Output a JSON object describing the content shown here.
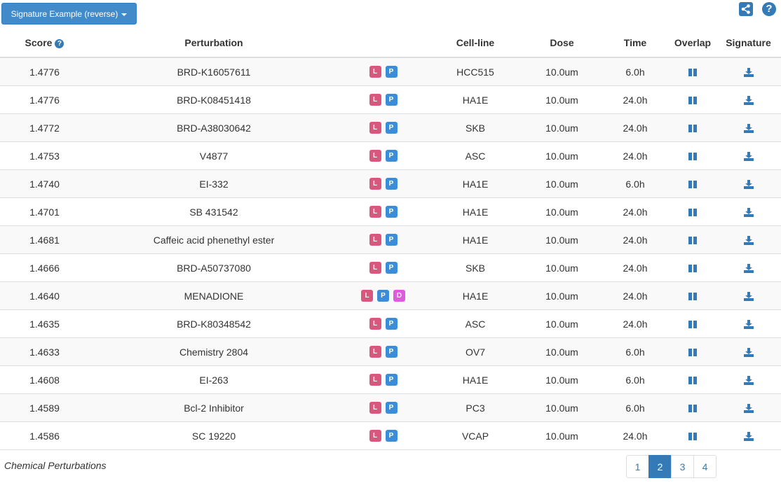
{
  "toolbar": {
    "signature_button_label": "Signature Example (reverse)",
    "share_icon": "share-alt-icon",
    "help_icon": "question-circle-icon",
    "help_label": "?"
  },
  "table": {
    "headers": {
      "score": "Score",
      "score_help": "?",
      "perturbation": "Perturbation",
      "cell_line": "Cell-line",
      "dose": "Dose",
      "time": "Time",
      "overlap": "Overlap",
      "signature": "Signature"
    },
    "rows": [
      {
        "score": "1.4776",
        "perturbation": "BRD-K16057611",
        "badges": [
          "L",
          "P"
        ],
        "cell_line": "HCC515",
        "dose": "10.0um",
        "time": "6.0h"
      },
      {
        "score": "1.4776",
        "perturbation": "BRD-K08451418",
        "badges": [
          "L",
          "P"
        ],
        "cell_line": "HA1E",
        "dose": "10.0um",
        "time": "24.0h"
      },
      {
        "score": "1.4772",
        "perturbation": "BRD-A38030642",
        "badges": [
          "L",
          "P"
        ],
        "cell_line": "SKB",
        "dose": "10.0um",
        "time": "24.0h"
      },
      {
        "score": "1.4753",
        "perturbation": "V4877",
        "badges": [
          "L",
          "P"
        ],
        "cell_line": "ASC",
        "dose": "10.0um",
        "time": "24.0h"
      },
      {
        "score": "1.4740",
        "perturbation": "EI-332",
        "badges": [
          "L",
          "P"
        ],
        "cell_line": "HA1E",
        "dose": "10.0um",
        "time": "6.0h"
      },
      {
        "score": "1.4701",
        "perturbation": "SB 431542",
        "badges": [
          "L",
          "P"
        ],
        "cell_line": "HA1E",
        "dose": "10.0um",
        "time": "24.0h"
      },
      {
        "score": "1.4681",
        "perturbation": "Caffeic acid phenethyl ester",
        "badges": [
          "L",
          "P"
        ],
        "cell_line": "HA1E",
        "dose": "10.0um",
        "time": "24.0h"
      },
      {
        "score": "1.4666",
        "perturbation": "BRD-A50737080",
        "badges": [
          "L",
          "P"
        ],
        "cell_line": "SKB",
        "dose": "10.0um",
        "time": "24.0h"
      },
      {
        "score": "1.4640",
        "perturbation": "MENADIONE",
        "badges": [
          "L",
          "P",
          "D"
        ],
        "cell_line": "HA1E",
        "dose": "10.0um",
        "time": "24.0h"
      },
      {
        "score": "1.4635",
        "perturbation": "BRD-K80348542",
        "badges": [
          "L",
          "P"
        ],
        "cell_line": "ASC",
        "dose": "10.0um",
        "time": "24.0h"
      },
      {
        "score": "1.4633",
        "perturbation": "Chemistry 2804",
        "badges": [
          "L",
          "P"
        ],
        "cell_line": "OV7",
        "dose": "10.0um",
        "time": "6.0h"
      },
      {
        "score": "1.4608",
        "perturbation": "EI-263",
        "badges": [
          "L",
          "P"
        ],
        "cell_line": "HA1E",
        "dose": "10.0um",
        "time": "6.0h"
      },
      {
        "score": "1.4589",
        "perturbation": "Bcl-2 Inhibitor",
        "badges": [
          "L",
          "P"
        ],
        "cell_line": "PC3",
        "dose": "10.0um",
        "time": "6.0h"
      },
      {
        "score": "1.4586",
        "perturbation": "SC 19220",
        "badges": [
          "L",
          "P"
        ],
        "cell_line": "VCAP",
        "dose": "10.0um",
        "time": "24.0h"
      }
    ],
    "overlap_icon": "columns-icon",
    "signature_icon": "download-icon"
  },
  "footer": {
    "caption": "Chemical Perturbations"
  },
  "pagination": {
    "pages": [
      "1",
      "2",
      "3",
      "4"
    ],
    "active": "2"
  },
  "colors": {
    "primary": "#428bca",
    "link": "#337ab7",
    "badge_L": "#d9577e",
    "badge_P": "#3b8cd9",
    "badge_D": "#e05ae0",
    "row_stripe": "#f9f9f9"
  }
}
